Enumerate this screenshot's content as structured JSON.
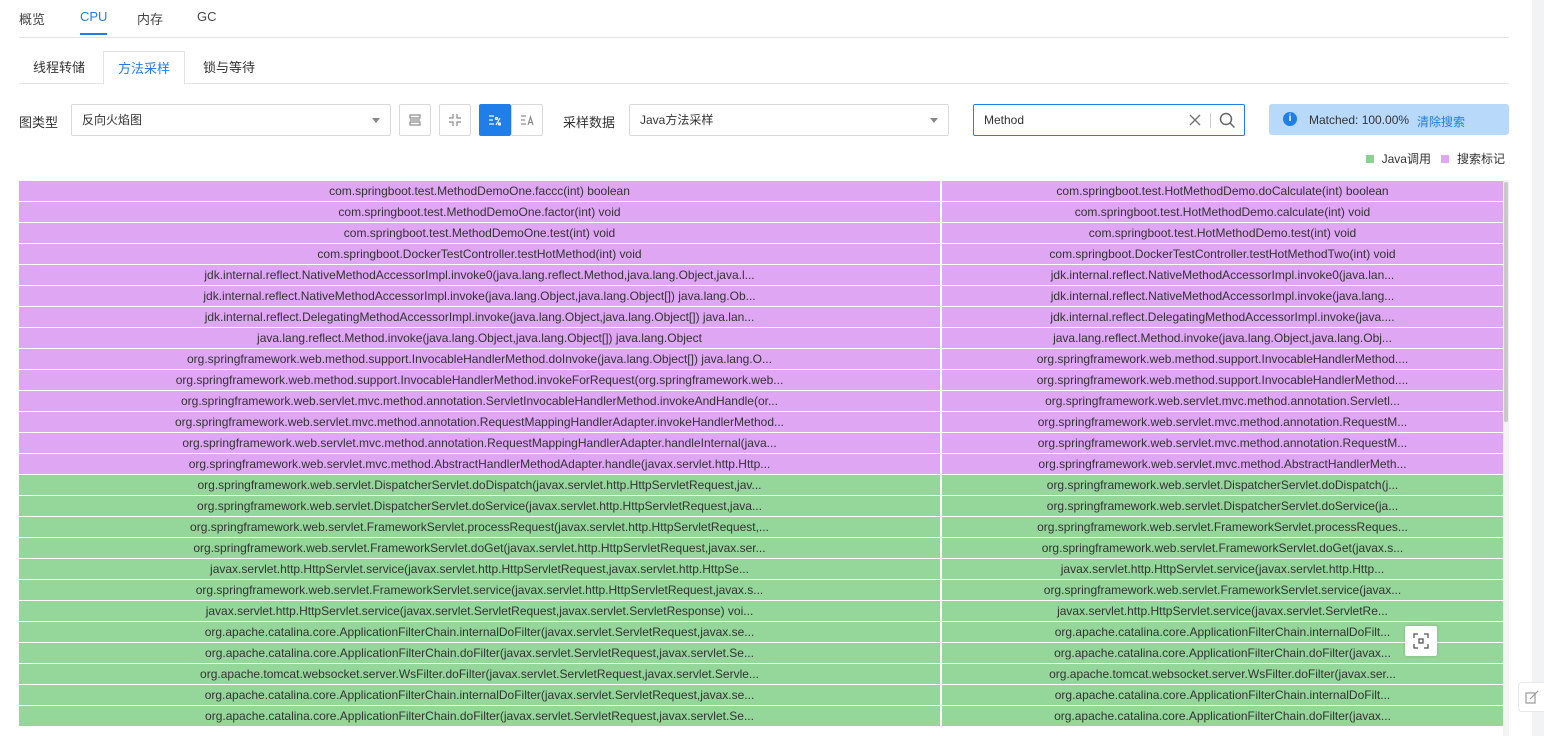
{
  "top_tabs": [
    {
      "label": "概览",
      "active": false
    },
    {
      "label": "CPU",
      "active": true
    },
    {
      "label": "内存",
      "active": false
    },
    {
      "label": "GC",
      "active": false
    }
  ],
  "sub_tabs": [
    {
      "label": "线程转储",
      "active": false
    },
    {
      "label": "方法采样",
      "active": true
    },
    {
      "label": "锁与等待",
      "active": false
    }
  ],
  "toolbar": {
    "chart_type_label": "图类型",
    "chart_type_value": "反向火焰图",
    "sample_data_label": "采样数据",
    "sample_data_value": "Java方法采样",
    "buttons": [
      "expand-rows-icon",
      "collapse-icon",
      "percent-sort-icon",
      "text-sort-icon"
    ],
    "active_button": "percent-sort-icon"
  },
  "search": {
    "value": "Method"
  },
  "matched": {
    "label": "Matched:  100.00%",
    "clear_label": "清除搜索"
  },
  "legend": [
    {
      "label": "Java调用",
      "color": "#8dd093"
    },
    {
      "label": "搜索标记",
      "color": "#dfa6f3"
    }
  ],
  "colors": {
    "accent": "#1f7ee8",
    "search_match": "#dfa6f3",
    "java_call": "#95d69a"
  },
  "flame": {
    "left_column": [
      {
        "text": "com.springboot.test.MethodDemoOne.faccc(int) boolean",
        "kind": "purple"
      },
      {
        "text": "com.springboot.test.MethodDemoOne.factor(int) void",
        "kind": "purple"
      },
      {
        "text": "com.springboot.test.MethodDemoOne.test(int) void",
        "kind": "purple"
      },
      {
        "text": "com.springboot.DockerTestController.testHotMethod(int) void",
        "kind": "purple"
      },
      {
        "text": "jdk.internal.reflect.NativeMethodAccessorImpl.invoke0(java.lang.reflect.Method,java.lang.Object,java.l...",
        "kind": "purple"
      },
      {
        "text": "jdk.internal.reflect.NativeMethodAccessorImpl.invoke(java.lang.Object,java.lang.Object[]) java.lang.Ob...",
        "kind": "purple"
      },
      {
        "text": "jdk.internal.reflect.DelegatingMethodAccessorImpl.invoke(java.lang.Object,java.lang.Object[]) java.lan...",
        "kind": "purple"
      },
      {
        "text": "java.lang.reflect.Method.invoke(java.lang.Object,java.lang.Object[]) java.lang.Object",
        "kind": "purple"
      },
      {
        "text": "org.springframework.web.method.support.InvocableHandlerMethod.doInvoke(java.lang.Object[]) java.lang.O...",
        "kind": "purple"
      },
      {
        "text": "org.springframework.web.method.support.InvocableHandlerMethod.invokeForRequest(org.springframework.web...",
        "kind": "purple"
      },
      {
        "text": "org.springframework.web.servlet.mvc.method.annotation.ServletInvocableHandlerMethod.invokeAndHandle(or...",
        "kind": "purple"
      },
      {
        "text": "org.springframework.web.servlet.mvc.method.annotation.RequestMappingHandlerAdapter.invokeHandlerMethod...",
        "kind": "purple"
      },
      {
        "text": "org.springframework.web.servlet.mvc.method.annotation.RequestMappingHandlerAdapter.handleInternal(java...",
        "kind": "purple"
      },
      {
        "text": "org.springframework.web.servlet.mvc.method.AbstractHandlerMethodAdapter.handle(javax.servlet.http.Http...",
        "kind": "purple"
      },
      {
        "text": "org.springframework.web.servlet.DispatcherServlet.doDispatch(javax.servlet.http.HttpServletRequest,jav...",
        "kind": "green"
      },
      {
        "text": "org.springframework.web.servlet.DispatcherServlet.doService(javax.servlet.http.HttpServletRequest,java...",
        "kind": "green"
      },
      {
        "text": "org.springframework.web.servlet.FrameworkServlet.processRequest(javax.servlet.http.HttpServletRequest,...",
        "kind": "green"
      },
      {
        "text": "org.springframework.web.servlet.FrameworkServlet.doGet(javax.servlet.http.HttpServletRequest,javax.ser...",
        "kind": "green"
      },
      {
        "text": "javax.servlet.http.HttpServlet.service(javax.servlet.http.HttpServletRequest,javax.servlet.http.HttpSe...",
        "kind": "green"
      },
      {
        "text": "org.springframework.web.servlet.FrameworkServlet.service(javax.servlet.http.HttpServletRequest,javax.s...",
        "kind": "green"
      },
      {
        "text": "javax.servlet.http.HttpServlet.service(javax.servlet.ServletRequest,javax.servlet.ServletResponse) voi...",
        "kind": "green"
      },
      {
        "text": "org.apache.catalina.core.ApplicationFilterChain.internalDoFilter(javax.servlet.ServletRequest,javax.se...",
        "kind": "green"
      },
      {
        "text": "org.apache.catalina.core.ApplicationFilterChain.doFilter(javax.servlet.ServletRequest,javax.servlet.Se...",
        "kind": "green"
      },
      {
        "text": "org.apache.tomcat.websocket.server.WsFilter.doFilter(javax.servlet.ServletRequest,javax.servlet.Servle...",
        "kind": "green"
      },
      {
        "text": "org.apache.catalina.core.ApplicationFilterChain.internalDoFilter(javax.servlet.ServletRequest,javax.se...",
        "kind": "green"
      },
      {
        "text": "org.apache.catalina.core.ApplicationFilterChain.doFilter(javax.servlet.ServletRequest,javax.servlet.Se...",
        "kind": "green"
      }
    ],
    "right_column": [
      {
        "text": "com.springboot.test.HotMethodDemo.doCalculate(int) boolean",
        "kind": "purple"
      },
      {
        "text": "com.springboot.test.HotMethodDemo.calculate(int) void",
        "kind": "purple"
      },
      {
        "text": "com.springboot.test.HotMethodDemo.test(int) void",
        "kind": "purple"
      },
      {
        "text": "com.springboot.DockerTestController.testHotMethodTwo(int) void",
        "kind": "purple"
      },
      {
        "text": "jdk.internal.reflect.NativeMethodAccessorImpl.invoke0(java.lan...",
        "kind": "purple"
      },
      {
        "text": "jdk.internal.reflect.NativeMethodAccessorImpl.invoke(java.lang...",
        "kind": "purple"
      },
      {
        "text": "jdk.internal.reflect.DelegatingMethodAccessorImpl.invoke(java....",
        "kind": "purple"
      },
      {
        "text": "java.lang.reflect.Method.invoke(java.lang.Object,java.lang.Obj...",
        "kind": "purple"
      },
      {
        "text": "org.springframework.web.method.support.InvocableHandlerMethod....",
        "kind": "purple"
      },
      {
        "text": "org.springframework.web.method.support.InvocableHandlerMethod....",
        "kind": "purple"
      },
      {
        "text": "org.springframework.web.servlet.mvc.method.annotation.Servletl...",
        "kind": "purple"
      },
      {
        "text": "org.springframework.web.servlet.mvc.method.annotation.RequestM...",
        "kind": "purple"
      },
      {
        "text": "org.springframework.web.servlet.mvc.method.annotation.RequestM...",
        "kind": "purple"
      },
      {
        "text": "org.springframework.web.servlet.mvc.method.AbstractHandlerMeth...",
        "kind": "purple"
      },
      {
        "text": "org.springframework.web.servlet.DispatcherServlet.doDispatch(j...",
        "kind": "green"
      },
      {
        "text": "org.springframework.web.servlet.DispatcherServlet.doService(ja...",
        "kind": "green"
      },
      {
        "text": "org.springframework.web.servlet.FrameworkServlet.processReques...",
        "kind": "green"
      },
      {
        "text": "org.springframework.web.servlet.FrameworkServlet.doGet(javax.s...",
        "kind": "green"
      },
      {
        "text": "javax.servlet.http.HttpServlet.service(javax.servlet.http.Http...",
        "kind": "green"
      },
      {
        "text": "org.springframework.web.servlet.FrameworkServlet.service(javax...",
        "kind": "green"
      },
      {
        "text": "javax.servlet.http.HttpServlet.service(javax.servlet.ServletRe...",
        "kind": "green"
      },
      {
        "text": "org.apache.catalina.core.ApplicationFilterChain.internalDoFilt...",
        "kind": "green"
      },
      {
        "text": "org.apache.catalina.core.ApplicationFilterChain.doFilter(javax...",
        "kind": "green"
      },
      {
        "text": "org.apache.tomcat.websocket.server.WsFilter.doFilter(javax.ser...",
        "kind": "green"
      },
      {
        "text": "org.apache.catalina.core.ApplicationFilterChain.internalDoFilt...",
        "kind": "green"
      },
      {
        "text": "org.apache.catalina.core.ApplicationFilterChain.doFilter(javax...",
        "kind": "green"
      }
    ]
  }
}
